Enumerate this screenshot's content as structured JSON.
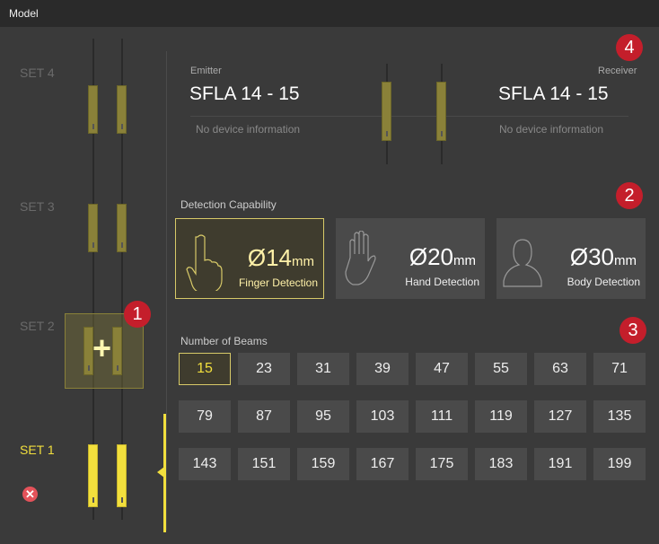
{
  "window": {
    "title": "Model"
  },
  "sets": {
    "items": [
      {
        "label": "SET 4",
        "active": false
      },
      {
        "label": "SET 3",
        "active": false
      },
      {
        "label": "SET 2",
        "active": false
      },
      {
        "label": "SET 1",
        "active": true
      }
    ],
    "add_label": "+",
    "remove_icon": "close-circle-icon"
  },
  "badges": [
    "1",
    "2",
    "3",
    "4"
  ],
  "device": {
    "emitter_label": "Emitter",
    "emitter_model": "SFLA 14 -  15",
    "emitter_info": "No device information",
    "receiver_label": "Receiver",
    "receiver_model": "SFLA 14 -  15",
    "receiver_info": "No device information"
  },
  "detection": {
    "title": "Detection Capability",
    "options": [
      {
        "value": "Ø14",
        "unit": "mm",
        "name": "Finger Detection",
        "icon": "finger-icon",
        "selected": true
      },
      {
        "value": "Ø20",
        "unit": "mm",
        "name": "Hand Detection",
        "icon": "hand-icon",
        "selected": false
      },
      {
        "value": "Ø30",
        "unit": "mm",
        "name": "Body Detection",
        "icon": "body-icon",
        "selected": false
      }
    ]
  },
  "beams": {
    "title": "Number of Beams",
    "values": [
      "15",
      "23",
      "31",
      "39",
      "47",
      "55",
      "63",
      "71",
      "79",
      "87",
      "95",
      "103",
      "111",
      "119",
      "127",
      "135",
      "143",
      "151",
      "159",
      "167",
      "175",
      "183",
      "191",
      "199"
    ],
    "selected": "15"
  },
  "colors": {
    "accent": "#f2df3d",
    "badge": "#c41e2b",
    "remove": "#e4525a"
  }
}
